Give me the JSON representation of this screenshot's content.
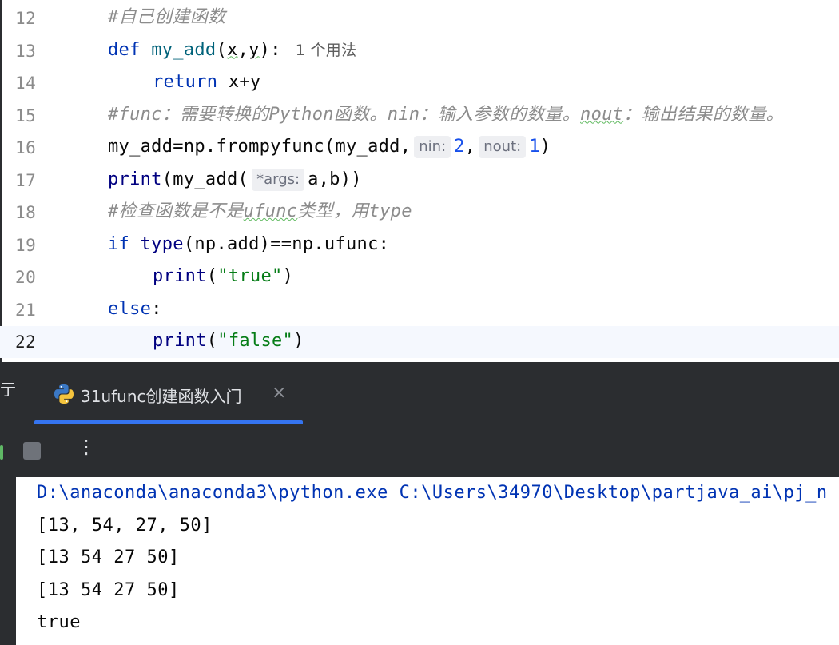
{
  "editor": {
    "current_line": "22",
    "lines": [
      {
        "number": "12",
        "tokens": [
          {
            "t": "#自己创建函数",
            "c": "cm"
          }
        ]
      },
      {
        "number": "13",
        "tokens": [
          {
            "t": "def",
            "c": "kw"
          },
          {
            "t": " "
          },
          {
            "t": "my_add",
            "c": "fn"
          },
          {
            "t": "("
          },
          {
            "t": "x",
            "c": "squig"
          },
          {
            "t": ","
          },
          {
            "t": "y",
            "c": "squig"
          },
          {
            "t": "):"
          }
        ],
        "usages": "1 个用法"
      },
      {
        "number": "14",
        "indent": 1,
        "tokens": [
          {
            "t": "return",
            "c": "kw"
          },
          {
            "t": " x+y"
          }
        ]
      },
      {
        "number": "15",
        "tokens": [
          {
            "t": "#func：需要转换的Python函数。nin：输入参数的数量。",
            "c": "cm"
          },
          {
            "t": "nout",
            "c": "cm squig"
          },
          {
            "t": "：输出结果的数量。",
            "c": "cm"
          }
        ]
      },
      {
        "number": "16",
        "tokens": [
          {
            "t": "my_add=np.frompyfunc(my_add,"
          },
          {
            "hint": "nin:"
          },
          {
            "t": "2",
            "c": "num"
          },
          {
            "t": ","
          },
          {
            "hint": "nout:"
          },
          {
            "t": "1",
            "c": "num"
          },
          {
            "t": ")"
          }
        ]
      },
      {
        "number": "17",
        "tokens": [
          {
            "t": "print",
            "c": "bi"
          },
          {
            "t": "("
          },
          {
            "t": "my_add("
          },
          {
            "hint": "*args:"
          },
          {
            "t": "a,b))"
          }
        ]
      },
      {
        "number": "18",
        "tokens": [
          {
            "t": "#检查函数是不是",
            "c": "cm"
          },
          {
            "t": "ufunc",
            "c": "cm squig"
          },
          {
            "t": "类型，用type",
            "c": "cm"
          }
        ]
      },
      {
        "number": "19",
        "tokens": [
          {
            "t": "if",
            "c": "kw"
          },
          {
            "t": " "
          },
          {
            "t": "type",
            "c": "bi"
          },
          {
            "t": "(np.add)==np.ufunc:"
          }
        ]
      },
      {
        "number": "20",
        "indent": 1,
        "tokens": [
          {
            "t": "print",
            "c": "bi"
          },
          {
            "t": "("
          },
          {
            "t": "\"true\"",
            "c": "str"
          },
          {
            "t": ")"
          }
        ]
      },
      {
        "number": "21",
        "tokens": [
          {
            "t": "else",
            "c": "kw"
          },
          {
            "t": ":"
          }
        ]
      },
      {
        "number": "22",
        "indent": 1,
        "tokens": [
          {
            "t": "print",
            "c": "bi"
          },
          {
            "t": "("
          },
          {
            "t": "\"false\"",
            "c": "str"
          },
          {
            "t": ")"
          }
        ]
      }
    ]
  },
  "run_window": {
    "title": "亍",
    "tab": {
      "label": "31ufunc创建函数入门",
      "icon": "python-icon",
      "close": "×"
    },
    "toolbar": {
      "more": "⋮"
    },
    "accent_color": "#3574f0"
  },
  "console": {
    "lines": [
      "D:\\anaconda\\anaconda3\\python.exe C:\\Users\\34970\\Desktop\\partjava_ai\\pj_n",
      "[13, 54, 27, 50]",
      "[13 54 27 50]",
      "[13 54 27 50]",
      "true"
    ]
  }
}
